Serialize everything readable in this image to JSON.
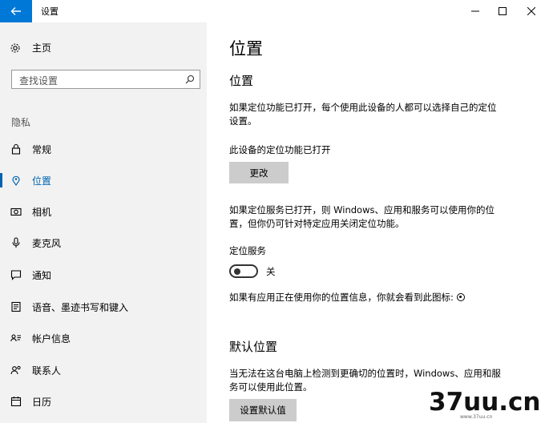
{
  "window": {
    "title": "设置",
    "controls": {
      "minimize": "minimize-icon",
      "maximize": "maximize-icon",
      "close": "close-icon"
    }
  },
  "sidebar": {
    "home_label": "主页",
    "search_placeholder": "查找设置",
    "section_label": "隐私",
    "items": [
      {
        "label": "常规",
        "icon": "lock-icon",
        "active": false
      },
      {
        "label": "位置",
        "icon": "location-pin-icon",
        "active": true
      },
      {
        "label": "相机",
        "icon": "camera-icon",
        "active": false
      },
      {
        "label": "麦克风",
        "icon": "microphone-icon",
        "active": false
      },
      {
        "label": "通知",
        "icon": "notification-icon",
        "active": false
      },
      {
        "label": "语音、墨迹书写和键入",
        "icon": "inking-icon",
        "active": false
      },
      {
        "label": "帐户信息",
        "icon": "account-info-icon",
        "active": false
      },
      {
        "label": "联系人",
        "icon": "contacts-icon",
        "active": false
      },
      {
        "label": "日历",
        "icon": "calendar-icon",
        "active": false
      }
    ]
  },
  "main": {
    "page_title": "位置",
    "section1_title": "位置",
    "section1_desc_line1": "如果定位功能已打开，每个使用此设备的人都可以选择自己的定位",
    "section1_desc_line2": "设置。",
    "device_status": "此设备的定位功能已打开",
    "change_button": "更改",
    "service_desc_line1": "如果定位服务已打开，则 Windows、应用和服务可以使用你的位",
    "service_desc_line2": "置，但你仍可针对特定应用关闭定位功能。",
    "service_label": "定位服务",
    "toggle_state": "关",
    "in_use_text": "如果有应用正在使用你的位置信息，你就会看到此图标:",
    "section2_title": "默认位置",
    "section2_desc_line1": "当无法在这台电脑上检测到更确切的位置时，Windows、应用和服",
    "section2_desc_line2": "务可以使用此位置。",
    "set_default_button": "设置默认值"
  },
  "watermark": {
    "text": "37uu.cn",
    "sub": "www.37uu.cn"
  },
  "colors": {
    "accent": "#0078d7",
    "active_text": "#0063b1",
    "sidebar_bg": "#f2f2f2",
    "button_bg": "#cccccc"
  }
}
